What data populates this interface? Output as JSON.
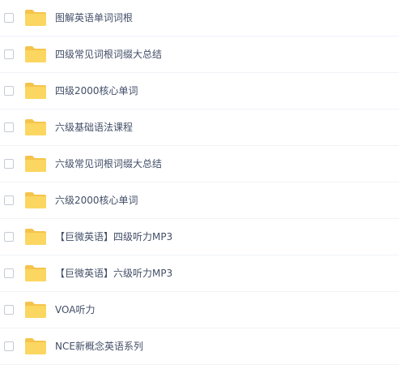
{
  "folder_icon": "folder-icon",
  "colors": {
    "folder_back": "#f5c44c",
    "folder_front": "#fbd661",
    "text": "#424e67",
    "divider": "#f1f3f8"
  },
  "files": [
    {
      "name": "图解英语单词词根"
    },
    {
      "name": "四级常见词根词缀大总结"
    },
    {
      "name": "四级2000核心单词"
    },
    {
      "name": "六级基础语法课程"
    },
    {
      "name": "六级常见词根词缀大总结"
    },
    {
      "name": "六级2000核心单词"
    },
    {
      "name": "【巨微英语】四级听力MP3"
    },
    {
      "name": "【巨微英语】六级听力MP3"
    },
    {
      "name": "VOA听力"
    },
    {
      "name": "NCE新概念英语系列"
    }
  ]
}
